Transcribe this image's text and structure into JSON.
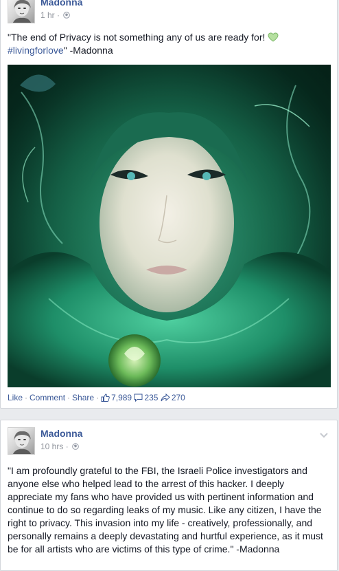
{
  "posts": [
    {
      "author": "Madonna",
      "time": "1 hr",
      "separator": " · ",
      "text_before": "\"The end of Privacy is not something any of us are ready for!",
      "hashtag": "#livingforlove",
      "text_after": "\" -Madonna",
      "actions": {
        "like": "Like",
        "comment": "Comment",
        "share": "Share",
        "like_count": "7,989",
        "comment_count": "235",
        "share_count": "270"
      }
    },
    {
      "author": "Madonna",
      "time": "10 hrs",
      "separator": " · ",
      "text": "\"I am profoundly grateful to the FBI, the Israeli Police investigators and anyone else who helped lead to the arrest of this hacker. I deeply appreciate my fans who have provided us with pertinent information and continue to do so regarding leaks of my music. Like any citizen, I have the right to privacy. This invasion into my life - creatively, professionally, and personally remains a deeply devastating and hurtful experience, as it must be for all artists who are victims of this type of crime.\" -Madonna"
    }
  ],
  "icons": {
    "avatar": "madonna-avatar",
    "privacy": "globe-icon",
    "emoji": "green-heart-icon",
    "options": "chevron-down-icon",
    "like": "thumbs-up-icon",
    "comment": "comment-bubble-icon",
    "share": "share-arrow-icon"
  },
  "colors": {
    "link": "#3b5998",
    "meta": "#90949c",
    "text": "#141823",
    "page_bg": "#e9ebee",
    "heart": "#9fd28a"
  }
}
